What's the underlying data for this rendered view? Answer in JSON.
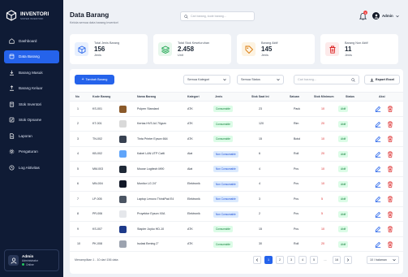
{
  "brand": {
    "title": "INVENTORI",
    "subtitle": "SISTEM INVENTORI"
  },
  "sidebar": {
    "items": [
      {
        "label": "Dashboard",
        "icon": "home-icon",
        "active": false
      },
      {
        "label": "Data Barang",
        "icon": "box-icon",
        "active": true
      },
      {
        "label": "Barang Masuk",
        "icon": "download-icon",
        "active": false
      },
      {
        "label": "Barang Keluar",
        "icon": "upload-icon",
        "active": false
      },
      {
        "label": "Stok Inventori",
        "icon": "clipboard-icon",
        "active": false
      },
      {
        "label": "Stok Opname",
        "icon": "checklist-icon",
        "active": false
      },
      {
        "label": "Laporan",
        "icon": "report-icon",
        "active": false
      },
      {
        "label": "Pengaturan",
        "icon": "gear-icon",
        "active": false
      },
      {
        "label": "Log Aktivitas",
        "icon": "clock-icon",
        "active": false
      }
    ],
    "user": {
      "name": "Admin",
      "role": "Administrator",
      "status": "Online"
    }
  },
  "header": {
    "title": "Data Barang",
    "subtitle": "Kelola semua data barang inventori",
    "search_placeholder": "Cari barang, kode barang...",
    "notification_count": "3",
    "user_label": "Admin"
  },
  "cards": [
    {
      "label": "Total Jenis Barang",
      "value": "156",
      "unit": "Jenis",
      "icon": "cube-icon",
      "color": "#2563eb",
      "bg": "#e8f0fe"
    },
    {
      "label": "Total Stok Keseluruhan",
      "value": "2.458",
      "unit": "Unit",
      "icon": "layers-icon",
      "color": "#16a34a",
      "bg": "#e7f7ec"
    },
    {
      "label": "Barang Aktif",
      "value": "145",
      "unit": "Jenis",
      "icon": "tag-icon",
      "color": "#d97706",
      "bg": "#fdf3e2"
    },
    {
      "label": "Barang Non Aktif",
      "value": "11",
      "unit": "Jenis",
      "icon": "trash-icon",
      "color": "#dc2626",
      "bg": "#fdeaea"
    }
  ],
  "toolbar": {
    "add_label": "Tambah Barang",
    "category_filter": "Semua Kategori",
    "status_filter": "Semua Status",
    "search_placeholder": "Cari barang...",
    "export_label": "Export Excel"
  },
  "table": {
    "headers": [
      "No",
      "Kode Barang",
      "Nama Barang",
      "Kategori",
      "Jenis",
      "Stok Saat Ini",
      "Satuan",
      "Stok Minimum",
      "Status",
      "Aksi"
    ],
    "rows": [
      {
        "no": "1",
        "code": "KS-001",
        "name": "Pulpen Standard",
        "category": "ATK",
        "type": "Consumable",
        "stock": "23",
        "unit": "Pack",
        "min": "10",
        "status": "Aktif",
        "thumb": "#8b5a2b"
      },
      {
        "no": "2",
        "code": "KT-001",
        "name": "Kertas HVS A4 70gsm",
        "category": "ATK",
        "type": "Consumable",
        "stock": "120",
        "unit": "Rim",
        "min": "20",
        "status": "Aktif",
        "thumb": "#d9d9d9"
      },
      {
        "no": "3",
        "code": "TN-002",
        "name": "Tinta Printer Epson 664",
        "category": "ATK",
        "type": "Consumable",
        "stock": "15",
        "unit": "Botol",
        "min": "10",
        "status": "Aktif",
        "thumb": "#374151"
      },
      {
        "no": "4",
        "code": "KB-002",
        "name": "Kabel LAN UTP Cat6",
        "category": "Alat",
        "type": "Non Consumable",
        "stock": "6",
        "unit": "Roll",
        "min": "20",
        "status": "Aktif",
        "thumb": "#60a5fa"
      },
      {
        "no": "5",
        "code": "MM-003",
        "name": "Mouse Logitech M90",
        "category": "Alat",
        "type": "Non Consumable",
        "stock": "4",
        "unit": "Pcs",
        "min": "10",
        "status": "Aktif",
        "thumb": "#1f2937"
      },
      {
        "no": "6",
        "code": "MN-004",
        "name": "Monitor LG 24\"",
        "category": "Elektronik",
        "type": "Non Consumable",
        "stock": "4",
        "unit": "Pcs",
        "min": "10",
        "status": "Aktif",
        "thumb": "#111827"
      },
      {
        "no": "7",
        "code": "LP-005",
        "name": "Laptop Lenovo ThinkPad E4",
        "category": "Elektronik",
        "type": "Non Consumable",
        "stock": "3",
        "unit": "Pcs",
        "min": "5",
        "status": "Aktif",
        "thumb": "#4b5563"
      },
      {
        "no": "8",
        "code": "PR-006",
        "name": "Proyektor Epson X0A",
        "category": "Elektronik",
        "type": "Non Consumable",
        "stock": "2",
        "unit": "Pcs",
        "min": "5",
        "status": "Aktif",
        "thumb": "#e5e7eb"
      },
      {
        "no": "9",
        "code": "KS-007",
        "name": "Stapler Joyko HD-10",
        "category": "ATK",
        "type": "Consumable",
        "stock": "15",
        "unit": "Pcs",
        "min": "10",
        "status": "Aktif",
        "thumb": "#1e3a8a"
      },
      {
        "no": "10",
        "code": "PK-008",
        "name": "Isolasi Bening 2\"",
        "category": "ATK",
        "type": "Consumable",
        "stock": "30",
        "unit": "Roll",
        "min": "20",
        "status": "Aktif",
        "thumb": "#9ca3af"
      }
    ]
  },
  "footer": {
    "summary": "Menampilkan 1 - 10 dari 156 data",
    "pages": [
      "1",
      "2",
      "3",
      "4",
      "5",
      "...",
      "16"
    ],
    "per_page": "10 / halaman"
  },
  "colors": {
    "primary": "#2563eb",
    "sidebar": "#0f1b35",
    "danger": "#dc2626",
    "success": "#16a34a"
  }
}
